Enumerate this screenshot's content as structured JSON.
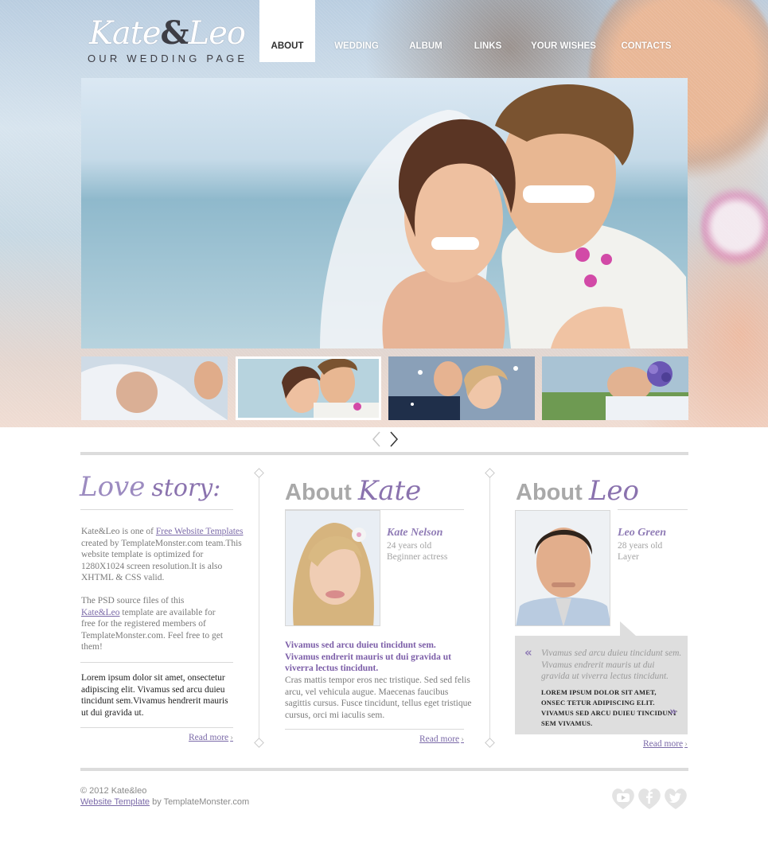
{
  "logo": {
    "name_left": "Kate",
    "amp": "&",
    "name_right": "Leo",
    "subtitle": "OUR WEDDING PAGE"
  },
  "nav": {
    "items": [
      {
        "label": "ABOUT",
        "active": true
      },
      {
        "label": "WEDDING",
        "active": false
      },
      {
        "label": "ALBUM",
        "active": false
      },
      {
        "label": "LINKS",
        "active": false
      },
      {
        "label": "YOUR WISHES",
        "active": false
      },
      {
        "label": "CONTACTS",
        "active": false
      }
    ]
  },
  "slider": {
    "selected_thumb": 2,
    "thumb_count": 4
  },
  "love_story": {
    "title_a": "Love",
    "title_b": "story:",
    "p1_a": "Kate&Leo is one of ",
    "p1_link": "Free Website Templates",
    "p1_b": " created by TemplateMonster.com team.This website template is optimized for 1280X1024 screen resolution.It is also XHTML & CSS valid.",
    "p2_a": "The PSD source files of this ",
    "p2_link": "Kate&Leo",
    "p2_b": " template are available for free for the registered members of TemplateMonster.com. Feel free to get them!",
    "p3": "Lorem ipsum dolor sit amet, onsectetur adipiscing elit. Vivamus sed arcu duieu tincidunt sem.Vivamus hendrerit mauris ut dui gravida ut.",
    "read_more": "Read more"
  },
  "about_kate": {
    "title_a": "About",
    "title_b": "Kate",
    "name": "Kate Nelson",
    "age": "24 years old",
    "role": "Beginner actress",
    "bold_text": "Vivamus sed arcu duieu tincidunt sem. Vivamus endrerit mauris ut dui gravida ut viverra lectus tincidunt.",
    "body_text": "Cras mattis tempor eros nec tristique. Sed sed felis arcu, vel vehicula augue. Maecenas faucibus sagittis cursus. Fusce tincidunt, tellus eget tristique cursus, orci mi iaculis sem.",
    "read_more": "Read more"
  },
  "about_leo": {
    "title_a": "About",
    "title_b": "Leo",
    "name": "Leo Green",
    "age": "28 years old",
    "role": "Layer",
    "quote_italic": "Vivamus sed arcu duieu tincidunt sem. Vivamus endrerit mauris ut dui gravida ut viverra lectus tincidunt.",
    "quote_bold": "LOREM IPSUM DOLOR SIT AMET, ONSEC TETUR ADIPISCING ELIT. VIVAMUS SED ARCU DUIEU TINCIDUNT SEM VIVAMUS.",
    "read_more": "Read more"
  },
  "footer": {
    "copyright": "© 2012  Kate&leo",
    "link": "Website Template",
    "by": " by TemplateMonster.com"
  },
  "social": [
    "youtube-icon",
    "facebook-icon",
    "twitter-icon"
  ],
  "colors": {
    "accent": "#8a72ae",
    "divider": "#dcdcdc",
    "quote_bg": "#dedede"
  }
}
